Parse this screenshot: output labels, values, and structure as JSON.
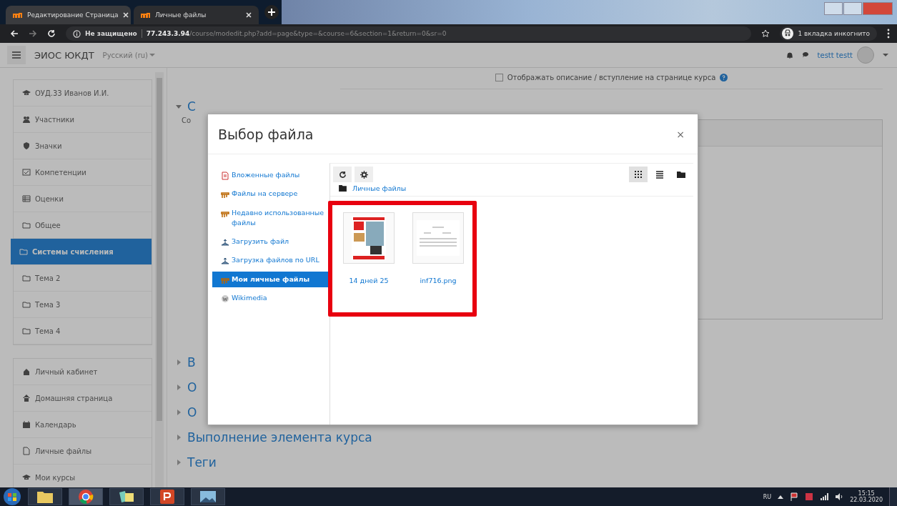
{
  "browser": {
    "tabs": [
      {
        "title": "Редактирование Страница",
        "selected": true
      },
      {
        "title": "Личные файлы",
        "selected": false
      }
    ],
    "address": {
      "security": "Не защищено",
      "host": "77.243.3.94",
      "path": "/course/modedit.php?add=page&type=&course=6&section=1&return=0&sr=0"
    },
    "incognito": "1 вкладка инкогнито"
  },
  "navbar": {
    "site_name": "ЭИОС ЮКДТ",
    "language": "Русский (ru)",
    "user": "testt testt"
  },
  "sidebar": {
    "groups": [
      [
        {
          "label": "ОУД.33 Иванов И.И.",
          "selected": false
        },
        {
          "label": "Участники",
          "selected": false
        },
        {
          "label": "Значки",
          "selected": false
        },
        {
          "label": "Компетенции",
          "selected": false
        },
        {
          "label": "Оценки",
          "selected": false
        },
        {
          "label": "Общее",
          "selected": false
        },
        {
          "label": "Системы счисления",
          "selected": true
        },
        {
          "label": "Тема 2",
          "selected": false
        },
        {
          "label": "Тема 3",
          "selected": false
        },
        {
          "label": "Тема 4",
          "selected": false
        }
      ],
      [
        {
          "label": "Личный кабинет",
          "selected": false
        },
        {
          "label": "Домашняя страница",
          "selected": false
        },
        {
          "label": "Календарь",
          "selected": false
        },
        {
          "label": "Личные файлы",
          "selected": false
        },
        {
          "label": "Мои курсы",
          "selected": false
        }
      ]
    ]
  },
  "page": {
    "show_description": {
      "label": "Отображать описание / вступление на странице курса",
      "checked": false
    },
    "sections": [
      {
        "heading": "С",
        "expanded": true,
        "hint": "Со"
      },
      {
        "heading": "В",
        "expanded": false
      },
      {
        "heading": "О",
        "expanded": false
      },
      {
        "heading": "О",
        "expanded": false
      },
      {
        "heading": "Выполнение элемента курса",
        "expanded": false
      },
      {
        "heading": "Теги",
        "expanded": false
      }
    ]
  },
  "file_picker": {
    "title": "Выбор файла",
    "close": "×",
    "sources": [
      {
        "label": "Вложенные файлы",
        "selected": false
      },
      {
        "label": "Файлы на сервере",
        "selected": false
      },
      {
        "label": "Недавно использованные файлы",
        "selected": false
      },
      {
        "label": "Загрузить файл",
        "selected": false
      },
      {
        "label": "Загрузка файлов по URL",
        "selected": false
      },
      {
        "label": "Мои личные файлы",
        "selected": true
      },
      {
        "label": "Wikimedia",
        "selected": false
      }
    ],
    "view_modes": [
      {
        "kind": "icons",
        "selected": true
      },
      {
        "kind": "list",
        "selected": false
      },
      {
        "kind": "tree",
        "selected": false
      }
    ],
    "breadcrumb": "Личные файлы",
    "files": [
      {
        "name": "14 дней 25",
        "kind": "poster"
      },
      {
        "name": "inf716.png",
        "kind": "document"
      }
    ]
  },
  "taskbar": {
    "language": "RU",
    "time": "15:15",
    "date": "22.03.2020"
  }
}
